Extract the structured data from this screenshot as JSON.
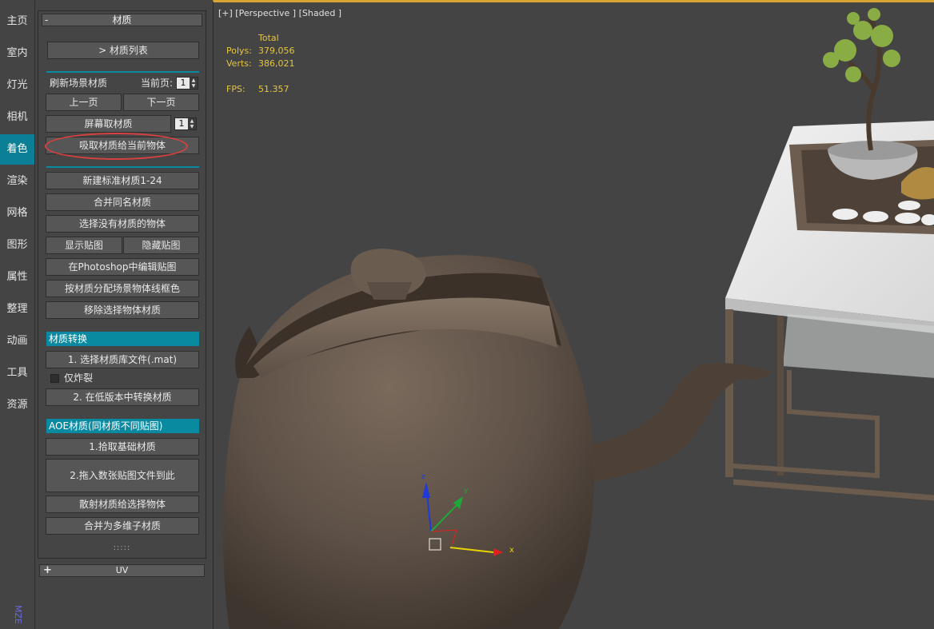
{
  "sidebar": {
    "tabs": [
      "主页",
      "室内",
      "灯光",
      "相机",
      "着色",
      "渲染",
      "网格",
      "图形",
      "属性",
      "整理",
      "动画",
      "工具",
      "资源"
    ],
    "active_index": 4,
    "footer": "MZE"
  },
  "panel": {
    "rollout_title": "材质",
    "material_list_btn": "> 材质列表",
    "refresh_label": "刷新场景材质",
    "current_page_label": "当前页:",
    "current_page_value": "1",
    "prev_page": "上一页",
    "next_page": "下一页",
    "screen_pick": "屏幕取材质",
    "screen_pick_value": "1",
    "assign_to_current": "吸取材质给当前物体",
    "new_std_materials": "新建标准材质1-24",
    "merge_same_name": "合并同名材质",
    "select_no_material": "选择没有材质的物体",
    "show_maps": "显示贴图",
    "hide_maps": "隐藏贴图",
    "edit_in_photoshop": "在Photoshop中编辑贴图",
    "wire_color_by_material": "按材质分配场景物体线框色",
    "remove_selected_material": "移除选择物体材质",
    "conversion_header": "材质转换",
    "select_lib_file": "1. 选择材质库文件(.mat)",
    "explode_only": "仅炸裂",
    "convert_low_version": "2. 在低版本中转换材质",
    "aoe_header": "AOE材质(同材质不同贴图)",
    "pick_base_material": "1.拾取基础材质",
    "drop_maps_here": "2.拖入数张贴图文件到此",
    "scatter_to_selected": "散射材质给选择物体",
    "merge_to_multisub": "合并为多维子材质",
    "dots": ":::::",
    "uv_rollout": "UV",
    "uv_plus": "+",
    "minus": "-"
  },
  "viewport": {
    "label": "[+] [Perspective ] [Shaded ]",
    "stats": {
      "total_label": "Total",
      "polys_label": "Polys:",
      "polys_value": "379,056",
      "verts_label": "Verts:",
      "verts_value": "386,021",
      "fps_label": "FPS:",
      "fps_value": "51.357"
    },
    "gizmo": {
      "x": "x",
      "y": "y",
      "z": "z"
    }
  }
}
